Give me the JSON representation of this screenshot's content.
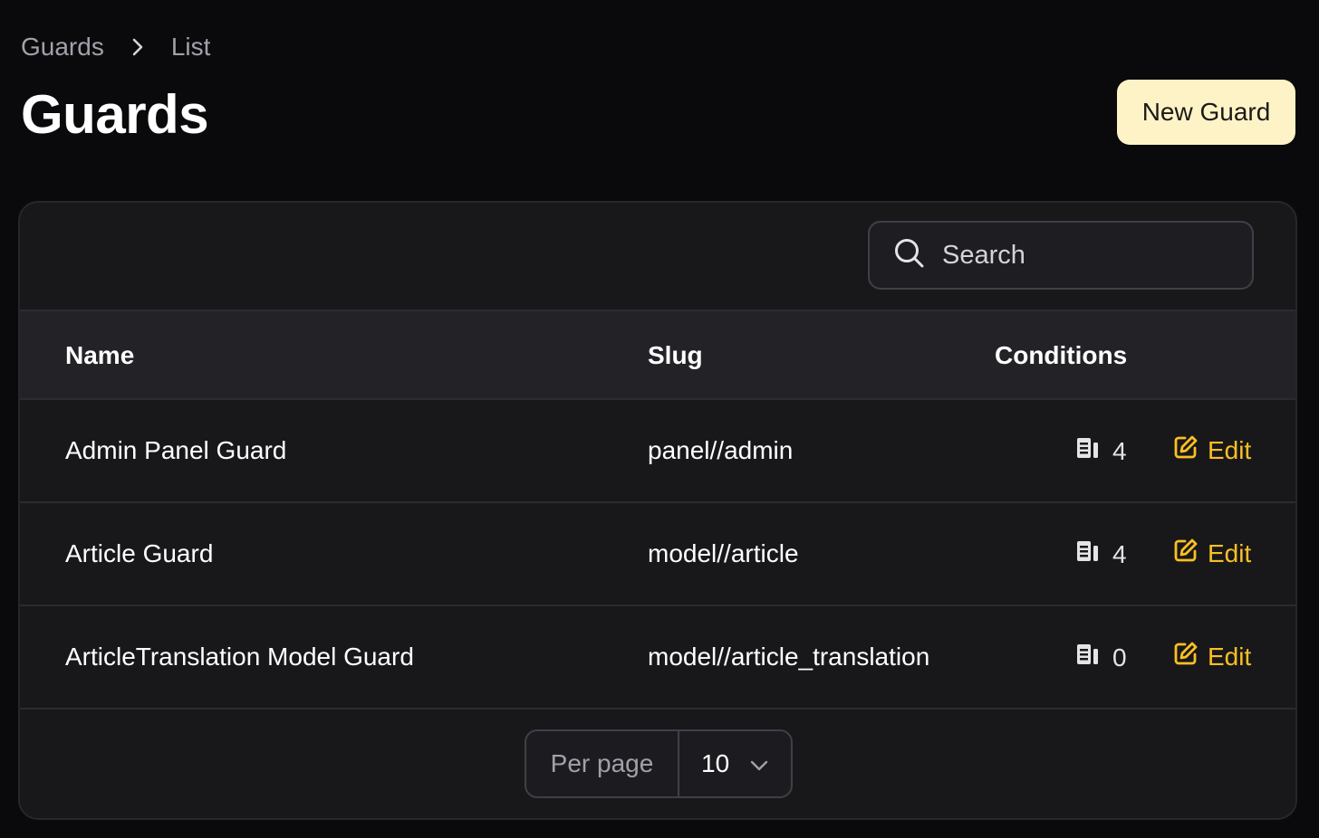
{
  "breadcrumb": {
    "items": [
      "Guards",
      "List"
    ]
  },
  "page": {
    "title": "Guards",
    "new_button": "New Guard"
  },
  "search": {
    "placeholder": "Search"
  },
  "table": {
    "headers": {
      "name": "Name",
      "slug": "Slug",
      "conditions": "Conditions"
    },
    "rows": [
      {
        "name": "Admin Panel Guard",
        "slug": "panel//admin",
        "conditions": "4",
        "action": "Edit"
      },
      {
        "name": "Article Guard",
        "slug": "model//article",
        "conditions": "4",
        "action": "Edit"
      },
      {
        "name": "ArticleTranslation Model Guard",
        "slug": "model//article_translation",
        "conditions": "0",
        "action": "Edit"
      }
    ]
  },
  "pagination": {
    "per_page_label": "Per page",
    "per_page_value": "10"
  },
  "colors": {
    "accent": "#fbbf24",
    "button_bg": "#fef3c7",
    "background": "#0a0a0c",
    "card": "#18181b"
  },
  "icons": {
    "separator": "chevron-right-icon",
    "search": "search-icon",
    "conditions": "list-icon",
    "edit": "edit-icon",
    "select": "chevron-down-icon"
  }
}
